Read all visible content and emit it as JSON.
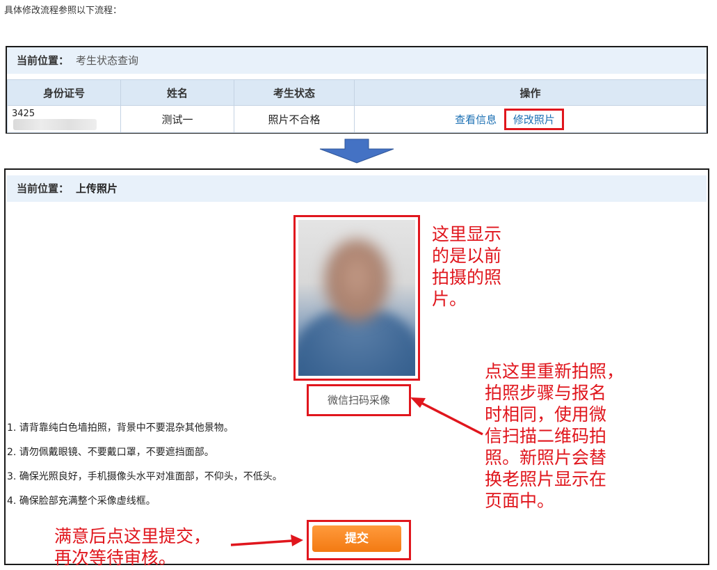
{
  "intro": "具体修改流程参照以下流程：",
  "panel1": {
    "crumb_key": "当前位置：",
    "crumb_val": "考生状态查询",
    "headers": [
      "身份证号",
      "姓名",
      "考生状态",
      "操作"
    ],
    "row": {
      "id_prefix": "3425",
      "name": "测试一",
      "status": "照片不合格",
      "view_link": "查看信息",
      "edit_link": "修改照片"
    }
  },
  "panel2": {
    "crumb_key": "当前位置：",
    "crumb_val": "上传照片",
    "wechat_button": "微信扫码采像",
    "rules": [
      "1. 请背靠纯白色墙拍照，背景中不要混杂其他景物。",
      "2. 请勿佩戴眼镜、不要戴口罩，不要遮挡面部。",
      "3. 确保光照良好，手机摄像头水平对准面部，不仰头，不低头。",
      "4. 确保脸部充满整个采像虚线框。"
    ],
    "submit_button": "提交"
  },
  "annotations": {
    "photo_note": [
      "这里显示",
      "的是以前",
      "拍摄的照",
      "片。"
    ],
    "wechat_note": [
      "点这里重新拍照，",
      "拍照步骤与报名",
      "时相同，使用微",
      "信扫描二维码拍",
      "照。新照片会替",
      "换老照片显示在",
      "页面中。"
    ],
    "submit_note": [
      "满意后点这里提交，",
      "再次等待审核。"
    ]
  },
  "colors": {
    "highlight_red": "#e0161d",
    "arrow_blue": "#4472c4",
    "submit_orange": "#f37a12",
    "header_blue": "#dbe8f5"
  },
  "icons": [
    "arrow-down-icon",
    "arrow-left-icon",
    "arrow-right-icon"
  ]
}
